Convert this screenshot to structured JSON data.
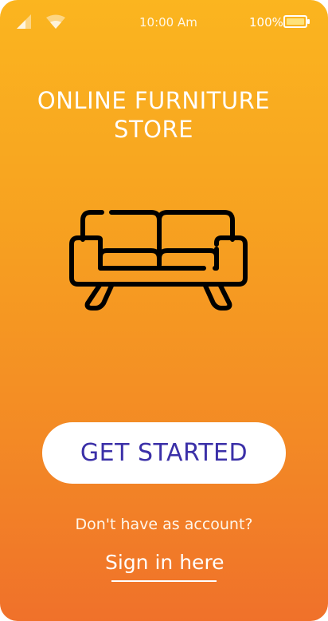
{
  "status_bar": {
    "time": "10:00 Am",
    "battery_percent": "100%",
    "signal_icon": "cellular-signal-icon",
    "wifi_icon": "wifi-icon",
    "battery_icon": "battery-icon"
  },
  "hero": {
    "title": "ONLINE FURNITURE STORE",
    "illustration_icon": "sofa-icon"
  },
  "actions": {
    "get_started_label": "GET STARTED",
    "question": "Don't have as account?",
    "signin_label": "Sign in here"
  },
  "colors": {
    "gradient_top": "#fbb51f",
    "gradient_bottom": "#f0712a",
    "button_text": "#3b30a8",
    "button_background": "#ffffff"
  }
}
